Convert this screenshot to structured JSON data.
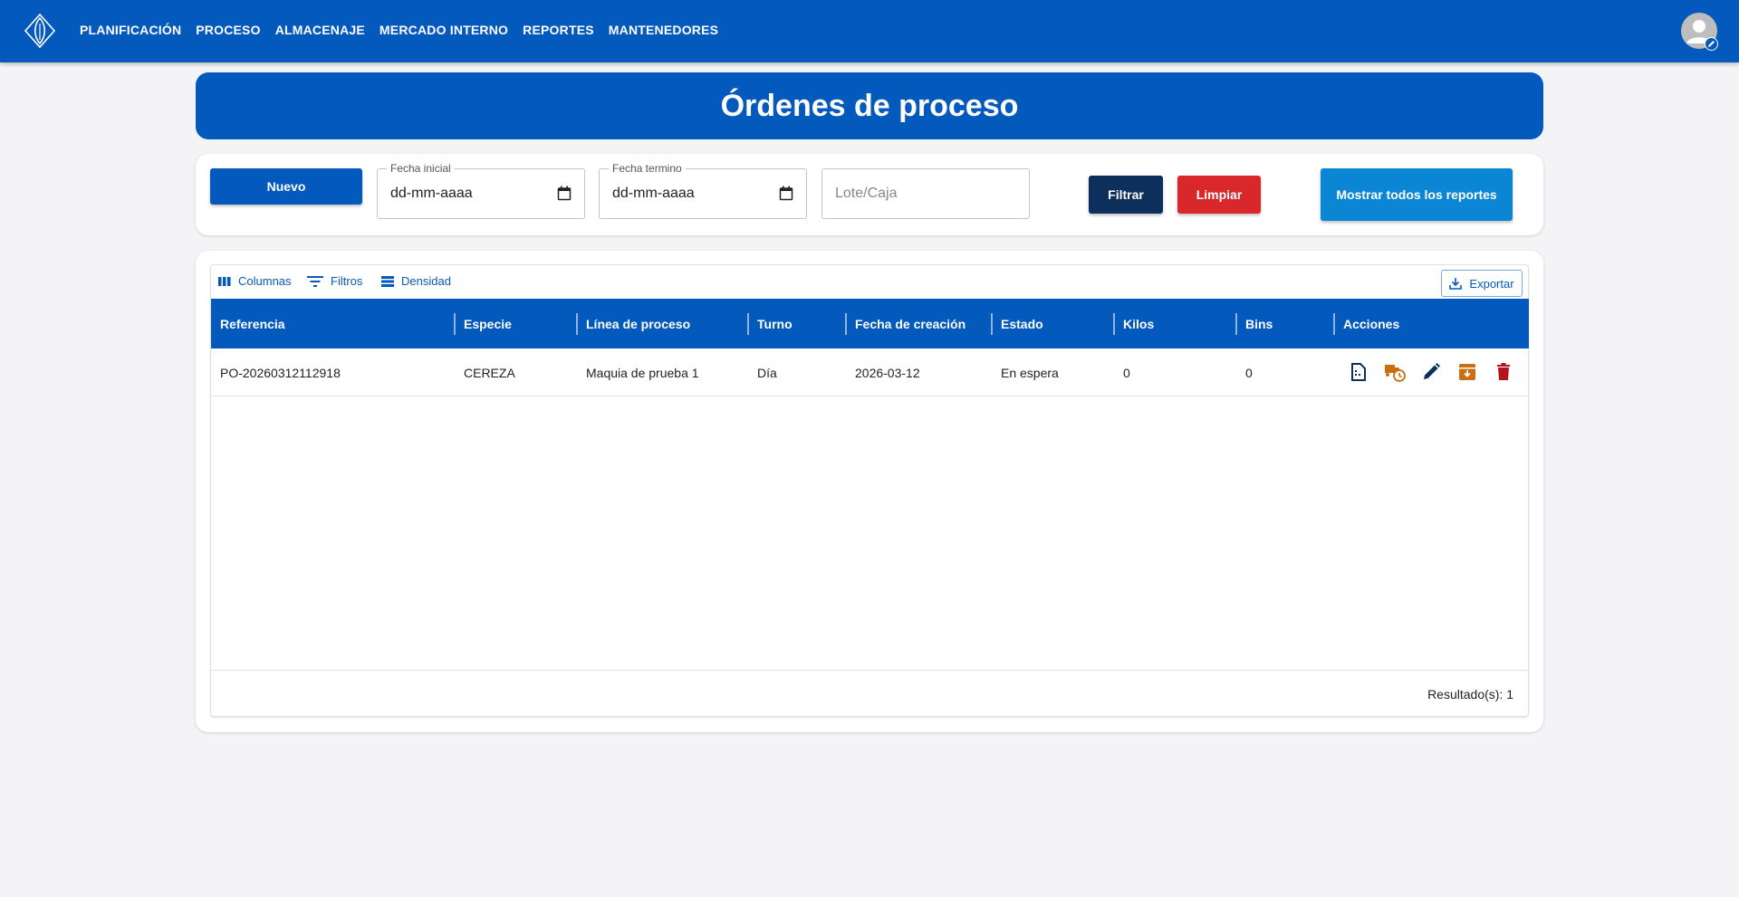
{
  "nav": {
    "items": [
      "PLANIFICACIÓN",
      "PROCESO",
      "ALMACENAJE",
      "MERCADO INTERNO",
      "REPORTES",
      "MANTENEDORES"
    ]
  },
  "page": {
    "title": "Órdenes de proceso"
  },
  "filters": {
    "new_label": "Nuevo",
    "fecha_inicial_label": "Fecha inicial",
    "fecha_inicial_value": "dd-mm-aaaa",
    "fecha_termino_label": "Fecha termino",
    "fecha_termino_value": "dd-mm-aaaa",
    "lote_placeholder": "Lote/Caja",
    "filter_label": "Filtrar",
    "clear_label": "Limpiar",
    "show_reports_label": "Mostrar todos los reportes"
  },
  "toolbar": {
    "columns_label": "Columnas",
    "filters_label": "Filtros",
    "density_label": "Densidad",
    "export_label": "Exportar"
  },
  "table": {
    "headers": [
      "Referencia",
      "Especie",
      "Línea de proceso",
      "Turno",
      "Fecha de creación",
      "Estado",
      "Kilos",
      "Bins",
      "Acciones"
    ],
    "rows": [
      [
        "PO-20260312112918",
        "CEREZA",
        "Maquia de prueba 1",
        "Día",
        "2026-03-12",
        "En espera",
        "0",
        "0"
      ]
    ],
    "result_count": "Resultado(s): 1"
  },
  "colors": {
    "primary": "#0459bd",
    "filter_button": "#0d2f5c",
    "clear_button": "#d8282c",
    "reports_button": "#0a86d4",
    "action_orange": "#c87010",
    "action_delete": "#b3141b",
    "action_navy": "#0d2f5c"
  },
  "icons": {
    "logo": "leaf-logo-icon",
    "avatar": "user-avatar-icon",
    "actions": [
      "document-icon",
      "truck-clock-icon",
      "pencil-icon",
      "archive-icon",
      "trash-icon"
    ]
  }
}
